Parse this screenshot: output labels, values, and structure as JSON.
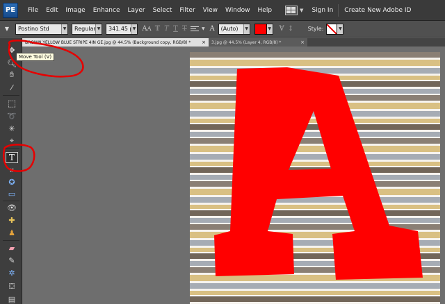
{
  "app": {
    "logo_text": "PE"
  },
  "menu": {
    "items": [
      "File",
      "Edit",
      "Image",
      "Enhance",
      "Layer",
      "Select",
      "Filter",
      "View",
      "Window",
      "Help"
    ],
    "sign_in": "Sign In",
    "create_id": "Create New Adobe ID"
  },
  "options": {
    "font_family": "Postino Std",
    "font_style": "Regular",
    "font_size": "341.45 p",
    "leading": "(Auto)",
    "color": "#ff0000",
    "style_label": "Style:"
  },
  "tabs": [
    {
      "title": "BROWN YELLOW BLUE STRIPE 4IN GE.jpg @ 44.5% (Background copy, RGB/8) *",
      "close": "×",
      "active": true
    },
    {
      "title": "3.jpg @ 44.5% (Layer 4, RGB/8) *",
      "close": "×",
      "active": false
    }
  ],
  "tooltip": {
    "text": "Move Tool (V)"
  },
  "canvas": {
    "letter": "A",
    "letter_color": "#ff0000",
    "annotation_color": "#e60000"
  },
  "toolbox": {
    "tools": [
      "move-tool",
      "zoom-tool",
      "hand-tool",
      "eyedropper-tool",
      "marquee-tool",
      "lasso-tool",
      "magic-wand-tool",
      "quick-selection-tool",
      "type-tool",
      "crop-tool",
      "cookie-cutter-tool",
      "straighten-tool",
      "red-eye-tool",
      "spot-healing-tool",
      "clone-stamp-tool",
      "eraser-tool",
      "brush-tool",
      "smart-brush-tool",
      "paint-bucket-tool"
    ]
  }
}
